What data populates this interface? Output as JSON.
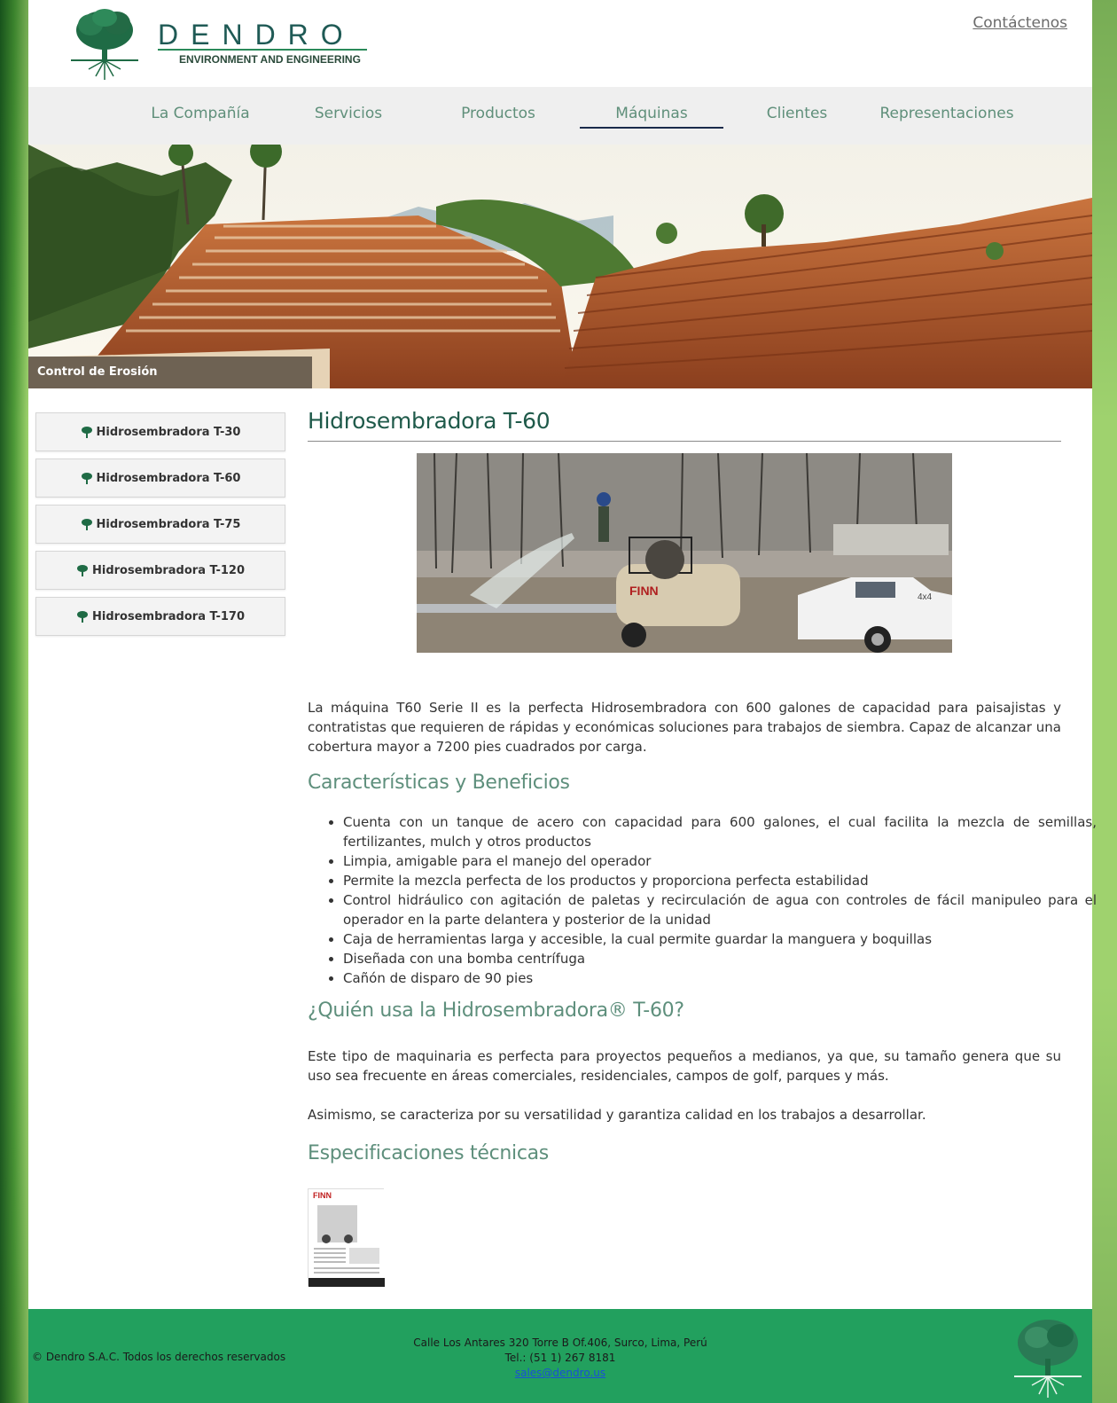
{
  "header": {
    "logo_title": "DENDRO",
    "logo_subtitle": "ENVIRONMENT AND ENGINEERING",
    "contact_link": "Contáctenos"
  },
  "nav": {
    "items": [
      {
        "label": "La Compañía"
      },
      {
        "label": "Servicios"
      },
      {
        "label": "Productos"
      },
      {
        "label": "Máquinas"
      },
      {
        "label": "Clientes"
      },
      {
        "label": "Representaciones"
      }
    ],
    "active": "Máquinas"
  },
  "banner": {
    "caption": "Control de Erosión"
  },
  "sidebar": {
    "items": [
      {
        "label": "Hidrosembradora T-30"
      },
      {
        "label": "Hidrosembradora T-60"
      },
      {
        "label": "Hidrosembradora T-75"
      },
      {
        "label": "Hidrosembradora T-120"
      },
      {
        "label": "Hidrosembradora T-170"
      }
    ]
  },
  "main": {
    "title": "Hidrosembradora T-60",
    "intro": "La máquina T60 Serie II es la perfecta Hidrosembradora con 600 galones de capacidad para paisajistas y contratistas que requieren de rápidas y económicas soluciones para trabajos de siembra. Capaz de alcanzar una cobertura mayor a 7200 pies cuadrados por carga.",
    "features_heading": "Características y Beneficios",
    "features": [
      "Cuenta con un tanque de acero con capacidad para 600 galones, el cual facilita la mezcla de semillas, fertilizantes, mulch y otros productos",
      "Limpia, amigable para el manejo del operador",
      "Permite la mezcla perfecta de los productos y proporciona perfecta estabilidad",
      "Control hidráulico con agitación de paletas y recirculación de agua con controles de fácil manipuleo para el operador en la parte delantera y posterior de la unidad",
      "Caja de herramientas larga y accesible, la cual permite guardar la manguera y boquillas",
      "Diseñada con una bomba centrífuga",
      "Cañón de disparo de 90 pies"
    ],
    "who_heading": "¿Quién usa la Hidrosembradora® T-60?",
    "who_p1": "Este tipo de maquinaria es perfecta para proyectos pequeños a medianos, ya que, su tamaño genera que su uso sea frecuente en áreas comerciales, residenciales, campos de golf, parques y más.",
    "who_p2": "Asimismo, se caracteriza por su versatilidad y garantiza calidad en los trabajos a desarrollar.",
    "specs_heading": "Especificaciones técnicas",
    "photo_brand": "FINN",
    "truck_badge": "4x4"
  },
  "footer": {
    "copyright": "© Dendro S.A.C. Todos los derechos reservados",
    "address": "Calle Los Antares 320 Torre B Of.406, Surco, Lima, Perú",
    "phone": "Tel.: (51 1) 267 8181",
    "email": "sales@dendro.us"
  },
  "colors": {
    "brand_green": "#1f6b45",
    "nav_text": "#5f8f7a",
    "footer_bg": "#22a05e",
    "heading_teal": "#5e8f7c"
  }
}
